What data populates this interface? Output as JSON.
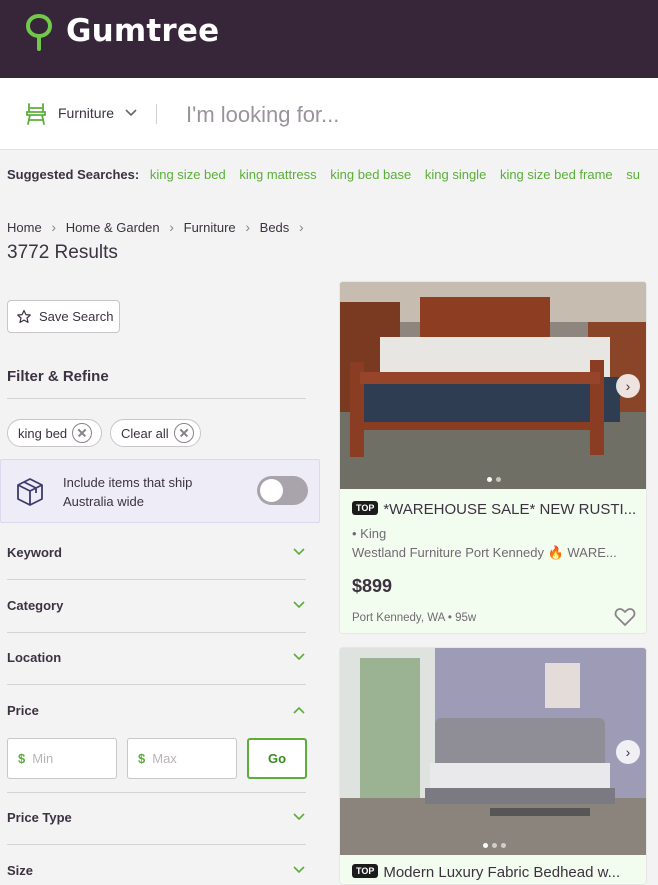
{
  "header": {
    "logo_text": "Gumtree",
    "logo_icon": "tree-icon"
  },
  "search": {
    "category": "Furniture",
    "category_icon": "furniture-icon",
    "placeholder": "I'm looking for..."
  },
  "suggested": {
    "label": "Suggested Searches:",
    "items": [
      "king size bed",
      "king mattress",
      "king bed base",
      "king single",
      "king size bed frame",
      "su"
    ]
  },
  "breadcrumb": [
    "Home",
    "Home & Garden",
    "Furniture",
    "Beds"
  ],
  "results": "3772 Results",
  "sidebar": {
    "save_search": "Save Search",
    "filter_title": "Filter & Refine",
    "chips": [
      "king bed",
      "Clear all"
    ],
    "ship_text": "Include items that ship Australia wide",
    "ship_toggle_on": false,
    "facets": [
      "Keyword",
      "Category",
      "Location",
      "Price",
      "Price Type",
      "Size"
    ],
    "price": {
      "currency": "$",
      "min_placeholder": "Min",
      "max_placeholder": "Max",
      "go_label": "Go"
    }
  },
  "listings": [
    {
      "badge": "TOP",
      "title": "*WAREHOUSE SALE* NEW RUSTI...",
      "line1": "• King",
      "line2": "Westland Furniture Port Kennedy 🔥 WARE...",
      "price": "$899",
      "location": "Port Kennedy, WA • 95w"
    },
    {
      "badge": "TOP",
      "title": "Modern Luxury Fabric Bedhead w..."
    }
  ],
  "colors": {
    "brand_dark": "#372639",
    "brand_green": "#5cae3b",
    "card_bg": "#f3fdef"
  }
}
